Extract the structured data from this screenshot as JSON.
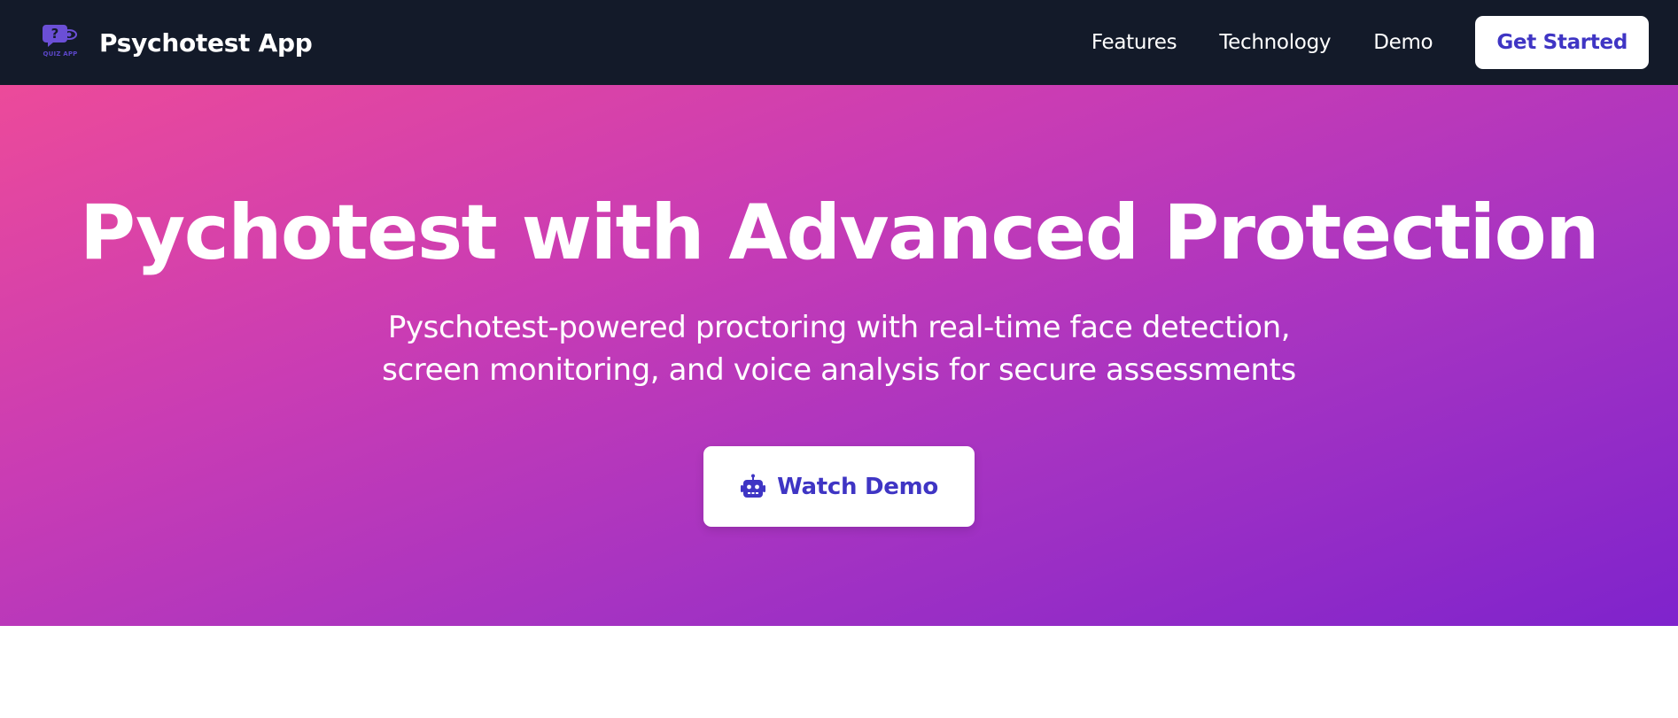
{
  "nav": {
    "logo_caption": "QUIZ APP",
    "brand": "Psychotest App",
    "links": [
      "Features",
      "Technology",
      "Demo"
    ],
    "cta": "Get Started"
  },
  "hero": {
    "title": "Pychotest with Advanced Protection",
    "subtitle": "Pyschotest-powered proctoring with real-time face detection, screen monitoring, and voice analysis for secure assessments",
    "button_label": "Watch Demo",
    "button_icon": "robot-icon"
  },
  "colors": {
    "navbar_bg": "#131a29",
    "accent": "#3f35c4",
    "hero_gradient_start": "#ec4a9a",
    "hero_gradient_end": "#7f23cc"
  }
}
